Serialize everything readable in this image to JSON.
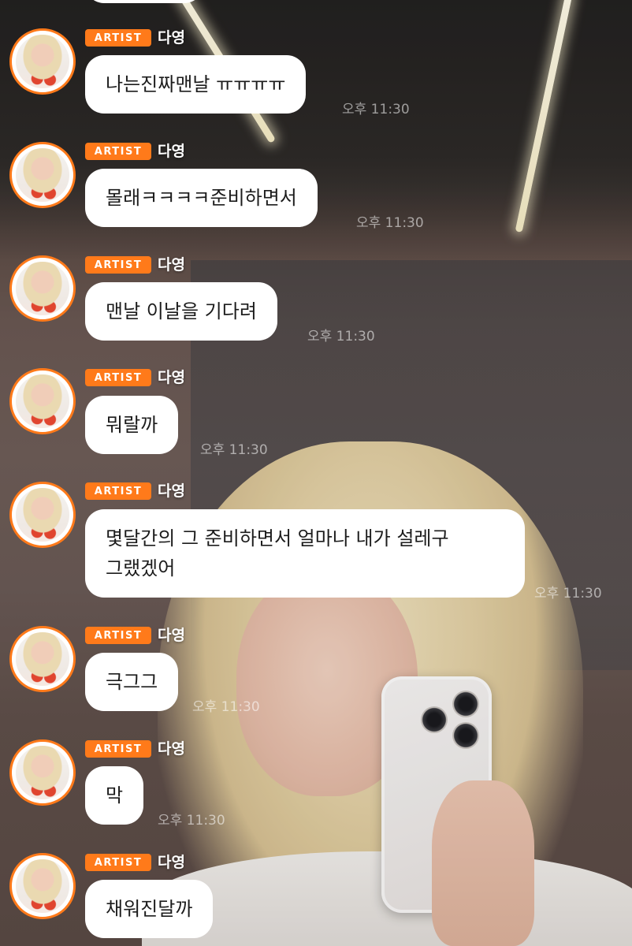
{
  "colors": {
    "badge": "#ff7a1a",
    "avatar_ring": "#ff7a1a",
    "bubble": "#ffffff",
    "bubble_text": "#1c1c1c",
    "timestamp": "#ffffff8c"
  },
  "messages": [
    {
      "badge": "ARTIST",
      "name": "다영",
      "text": "나는진짜맨날 ㅠㅠㅠㅠ",
      "time": "오후 11:30"
    },
    {
      "badge": "ARTIST",
      "name": "다영",
      "text": "몰래ㅋㅋㅋㅋ준비하면서",
      "time": "오후 11:30"
    },
    {
      "badge": "ARTIST",
      "name": "다영",
      "text": "맨날 이날을 기다려",
      "time": "오후 11:30"
    },
    {
      "badge": "ARTIST",
      "name": "다영",
      "text": "뭐랄까",
      "time": "오후 11:30"
    },
    {
      "badge": "ARTIST",
      "name": "다영",
      "text": "몇달간의 그 준비하면서 얼마나 내가 설레구",
      "text2": "그랬겠어",
      "time": "오후 11:30"
    },
    {
      "badge": "ARTIST",
      "name": "다영",
      "text": "극그그",
      "time": "오후 11:30"
    },
    {
      "badge": "ARTIST",
      "name": "다영",
      "text": "막",
      "time": "오후 11:30"
    },
    {
      "badge": "ARTIST",
      "name": "다영",
      "text": "채워진달까"
    }
  ]
}
